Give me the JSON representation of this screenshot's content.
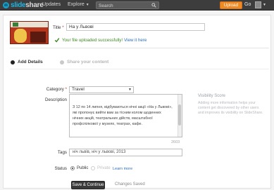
{
  "nav": {
    "logo_prefix": "slide",
    "logo_suffix": "share",
    "updates": "Updates",
    "explore": "Explore",
    "search_placeholder": "Search",
    "upload": "Upload",
    "go": "Go"
  },
  "upload": {
    "title_label": "Title",
    "title_value": "На у Львові",
    "success_message": "Your file uploaded successfully!",
    "success_link": "View it here",
    "step1": "Add Details",
    "step2": "Share your content"
  },
  "form": {
    "category_label": "Category",
    "category_value": "Travel",
    "description_label": "Description",
    "description_text": "З 12 по 14 липня, відбуваються нічні акції «На у Львові», які пропонує вийти вам за тісним колом щоденних нічних акцій, театральних дійств, масштабної профспілкової у музеях, театрах, кафе.",
    "char_count": "2603",
    "tags_label": "Tags",
    "tags_value": "ніч львів, ніч у львові, 2013",
    "status_label": "Status",
    "public_label": "Public",
    "private_label": "Private",
    "learn_more": "Learn more",
    "save_button": "Save & Continue",
    "changes_saved": "Changes Saved"
  },
  "sidebar": {
    "vis_title": "Visibility Score",
    "vis_desc": "Adding more information helps your content get discovered by other users and improves its visibility on SlideShare."
  },
  "colors": {
    "accent": "#f08a24",
    "nav_bg": "#3d3d3d",
    "success": "#3f8a24",
    "link": "#2a6ebb"
  }
}
